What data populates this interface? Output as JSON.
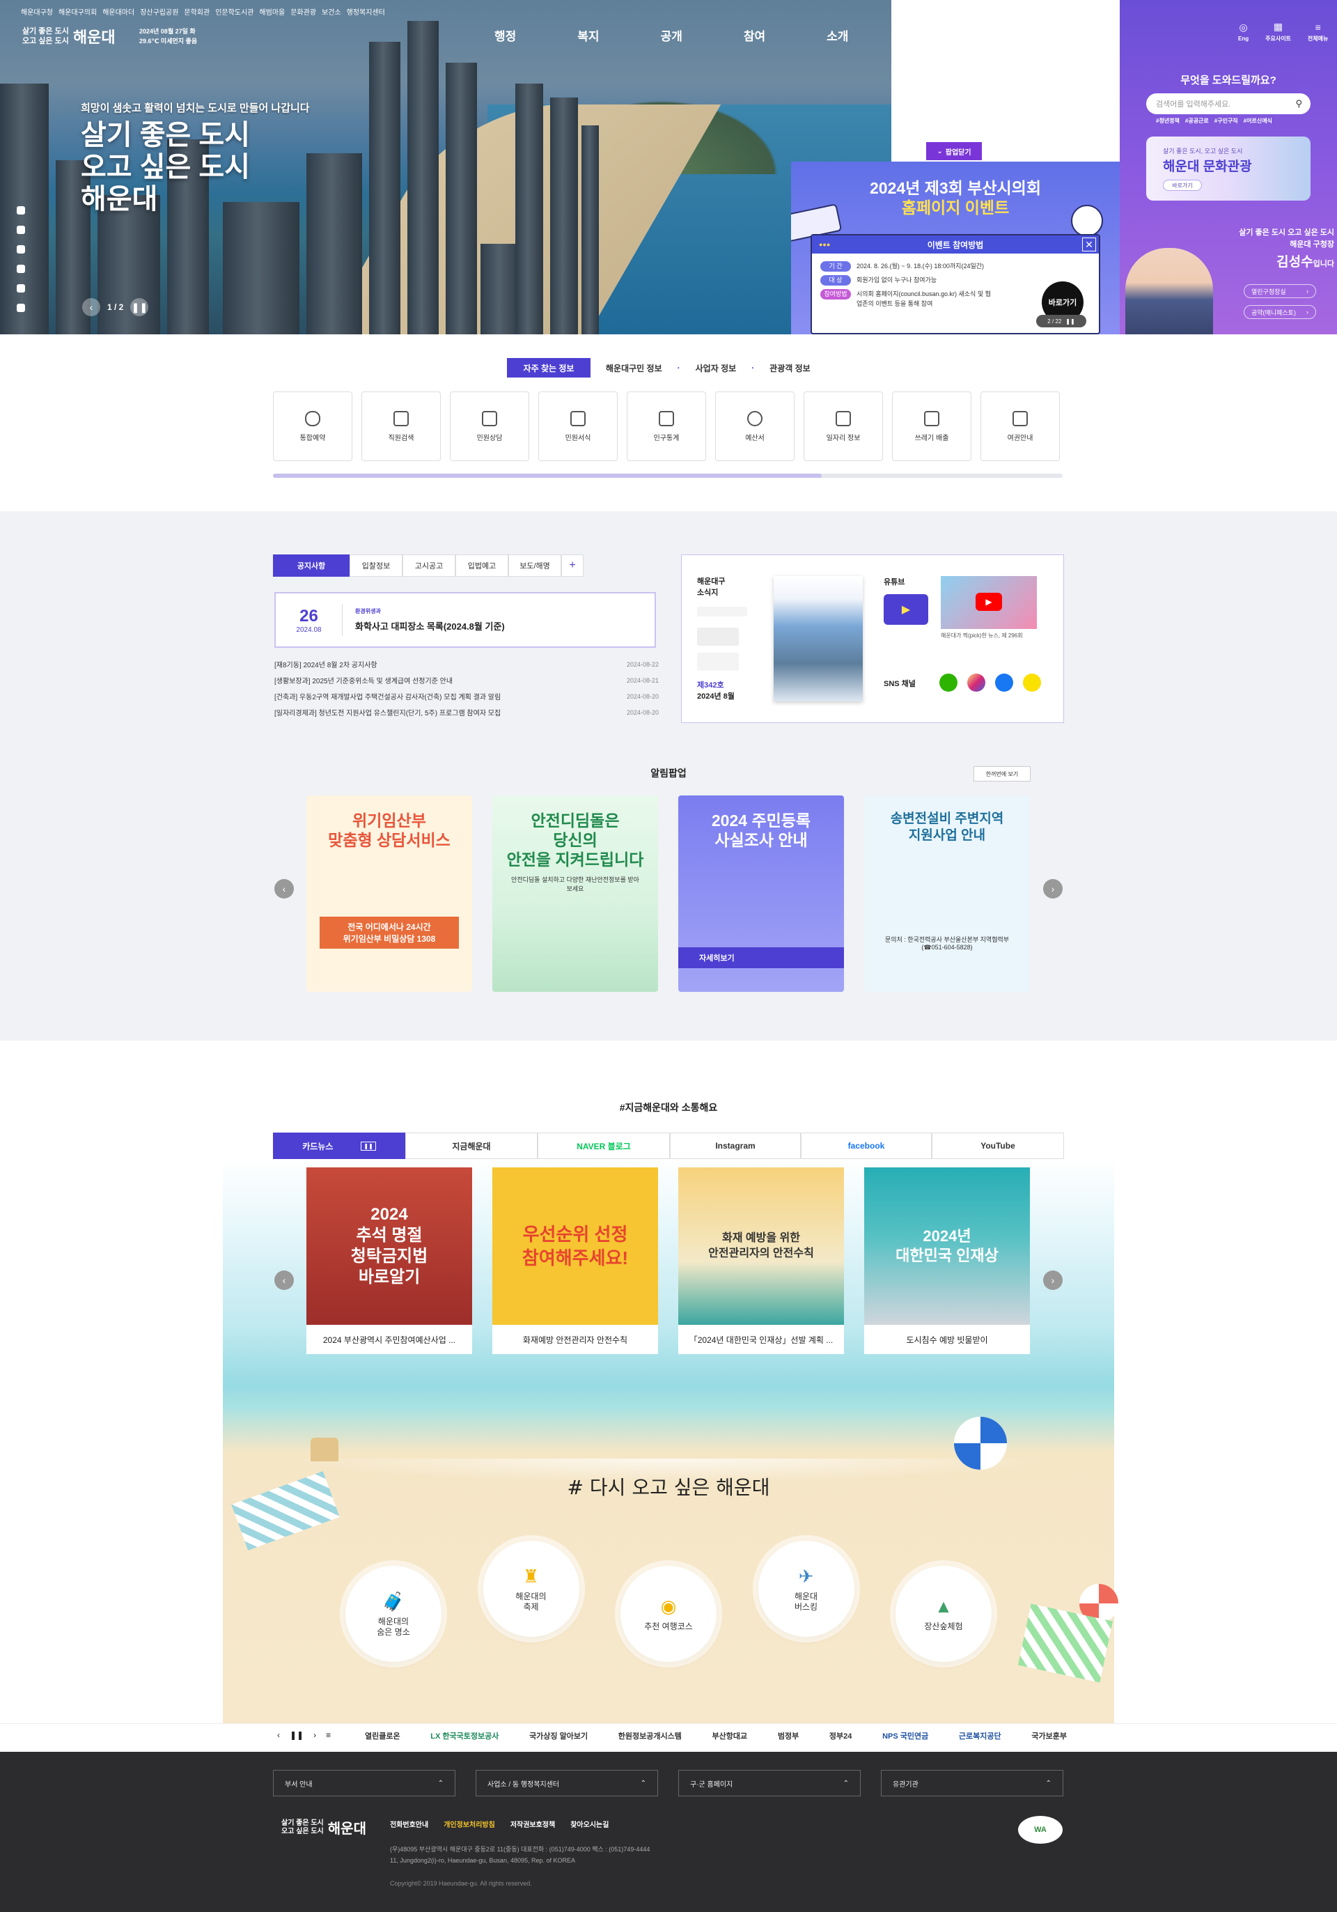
{
  "top_links": [
    "해운대구청",
    "해운대구의회",
    "해운대마더",
    "장산구립공원",
    "문학회관",
    "인문학도시관",
    "해범마을",
    "문화관광",
    "보건소",
    "행정복지센터"
  ],
  "logo": {
    "line1": "살기 좋은 도시",
    "line2": "오고 싶은 도시",
    "brand": "해운대"
  },
  "weather": {
    "date": "2024년 08월 27일 화",
    "temp": "29.6℃ 미세먼지 좋음"
  },
  "gnb": [
    "행정",
    "복지",
    "공개",
    "참여",
    "소개"
  ],
  "hero": {
    "tagline": "희망이 샘솟고 활력이 넘치는 도시로 만들어 나갑니다",
    "title1": "살기 좋은 도시",
    "title2": "오고 싶은 도시",
    "title3": "해운대",
    "pager": "1 / 2"
  },
  "util": [
    {
      "icon": "globe-icon",
      "label": "Eng"
    },
    {
      "icon": "grid-icon",
      "label": "주요사이트"
    },
    {
      "icon": "menu-icon",
      "label": "전체메뉴"
    }
  ],
  "search": {
    "heading": "무엇을 도와드릴까요?",
    "placeholder": "검색어를 입력해주세요.",
    "tags": [
      "#청년정책",
      "#공공근로",
      "#구인구직",
      "#어르신예식"
    ]
  },
  "culture": {
    "sub": "살기 좋은 도시, 오고 싶은 도시",
    "title": "해운대 문화관광",
    "btn": "바로가기"
  },
  "mayor": {
    "slogan": "살기 좋은 도시 오고 싶은 도시",
    "org": "해운대 구청장",
    "name": "김성수",
    "suffix": "입니다",
    "btn1": "열린구청장실",
    "btn2": "공약(매니페스토)"
  },
  "event": {
    "close_label": "팝업닫기",
    "title1": "2024년 제3회 부산시의회",
    "title2": "홈페이지 이벤트",
    "win_title": "이벤트 참여방법",
    "rows": [
      {
        "tag": "기 간",
        "text": "2024. 8. 26.(월) ~ 9. 18.(수) 18:00까지(24일간)"
      },
      {
        "tag": "대 상",
        "text": "회원가입 없이 누구나 참여가능"
      },
      {
        "tag": "참여방법",
        "text": "시의회 홈페이지(council.busan.go.kr) 새소식 및 협업존의 이벤트 등을 통해 참여"
      }
    ],
    "go": "바로가기",
    "pager": "2 / 22"
  },
  "quick": {
    "tabs": [
      "자주 찾는 정보",
      "해운대구민 정보",
      "사업자 정보",
      "관광객 정보"
    ],
    "items": [
      "통합예약",
      "직원검색",
      "민원상담",
      "민원서식",
      "인구통계",
      "예산서",
      "일자리 정보",
      "쓰레기 배출",
      "여권안내"
    ]
  },
  "notice": {
    "tabs": [
      "공지사항",
      "입찰정보",
      "고시공고",
      "입법예고",
      "보도/해명",
      "+"
    ],
    "featured": {
      "day": "26",
      "ym": "2024.08",
      "dept": "환경위생과",
      "title": "화학사고 대피장소 목록(2024.8월 기준)"
    },
    "rows": [
      {
        "t": "[재8기동] 2024년 8월 2차 공지사항",
        "d": "2024-08-22"
      },
      {
        "t": "[생활보장과] 2025년 기준중위소득 및 생계급여 선정기준 안내",
        "d": "2024-08-21"
      },
      {
        "t": "[건축과] 우동2구역 재개발사업 주택건설공사 감사자(건축) 모집 계획 결과 알림",
        "d": "2024-08-20"
      },
      {
        "t": "[일자리경제과] 청년도전 지원사업 유스챌린지(단기, 5주) 프로그램 참여자 모집",
        "d": "2024-08-20"
      }
    ]
  },
  "news": {
    "label1": "해운대구",
    "label2": "소식지",
    "issue": "제342호",
    "issue_date": "2024년 8월",
    "yt_label": "유튜브",
    "yt_title": "해운대가 찍(pick)한 뉴스, 제 296회",
    "sns_label": "SNS 채널"
  },
  "alert": {
    "title": "알림팝업",
    "all": "한꺼번에 보기",
    "items": [
      {
        "title": "위기임산부\n맞춤형 상담서비스",
        "foot": "전국 어디에서나 24시간\n위기임산부 비밀상담 1308"
      },
      {
        "title": "안전디딤돌은\n당신의\n안전을 지켜드립니다",
        "foot": "안전디딤돌 설치하고 다양한 재난안전정보를 받아보세요"
      },
      {
        "title": "2024 주민등록\n사실조사 안내",
        "foot": "자세히보기"
      },
      {
        "title": "송변전설비 주변지역\n지원사업 안내",
        "foot": "문의처 : 한국전력공사 부산울산본부 지역협력부 (☎051-604-5828)"
      }
    ]
  },
  "sns": {
    "title": "#지금해운대와 소통해요",
    "tabs": [
      "카드뉴스",
      "지금해운대",
      "NAVER 블로그",
      "Instagram",
      "facebook",
      "YouTube"
    ],
    "cards": [
      {
        "t": "2024 부산광역시 주민참여예산사업 ...",
        "img": "2024\n추석 명절\n청탁금지법\n바로알기"
      },
      {
        "t": "화재예방 안전관리자 안전수칙",
        "img": "우선순위 선정\n참여해주세요!"
      },
      {
        "t": "「2024년 대한민국 인재상」선발 계획 ...",
        "img": "화재 예방을 위한\n안전관리자의 안전수칙"
      },
      {
        "t": "도시침수 예방 빗물받이",
        "img": "2024년\n대한민국 인재상"
      }
    ]
  },
  "beach": {
    "slogan": "# 다시 오고 싶은 해운대",
    "items": [
      "해운대의\n숨은 명소",
      "해운대의\n축제",
      "추천 여행코스",
      "해운대\n버스킹",
      "장산숲체험"
    ]
  },
  "banners": [
    "열린클로온",
    "LX 한국국토정보공사",
    "국가상징 알아보기",
    "한원정보공개시스템",
    "부산항대교",
    "범정부",
    "정부24",
    "NPS 국민연금",
    "근로복지공단",
    "국가보훈부"
  ],
  "footer": {
    "selects": [
      "부서 안내",
      "사업소 / 동 행정복지센터",
      "구·군 홈페이지",
      "유관기관"
    ],
    "links": [
      "전화번호안내",
      "개인정보처리방침",
      "저작권보호정책",
      "찾아오시는길"
    ],
    "addr1": "(우)48095 부산광역시 해운대구 중동2로 11(중동)  대표전화 : (051)749-4000  팩스 : (051)749-4444",
    "addr2": "11, Jungdong2(i)-ro, Haeundae-gu, Busan, 48095, Rep. of KOREA",
    "copy": "Copyright© 2019 Haeundae-gu. All rights reserved."
  }
}
